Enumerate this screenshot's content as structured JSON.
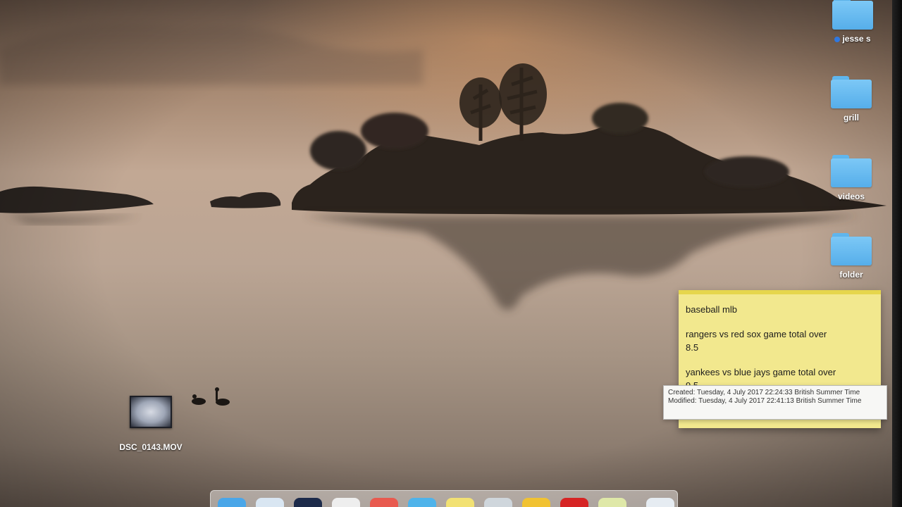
{
  "desktop": {
    "folders": [
      {
        "label": "jesse s",
        "tagged": true
      },
      {
        "label": "grill",
        "tagged": false
      },
      {
        "label": "videos",
        "tagged": false
      },
      {
        "label": "folder",
        "tagged": false
      }
    ],
    "file": {
      "label": "DSC_0143.MOV"
    }
  },
  "sticky_note": {
    "line1": "baseball mlb",
    "line2": "rangers vs red sox game total over",
    "line3": "8.5",
    "line4": "yankees vs blue jays game total over",
    "line5": "9.5"
  },
  "tooltip": {
    "created": "Created: Tuesday, 4 July 2017 22:24:33 British Summer Time",
    "modified": "Modified: Tuesday, 4 July 2017 22:41:13 British Summer Time"
  },
  "dock": {
    "items": [
      {
        "icon": "finder-icon",
        "color": "#4aa6e8"
      },
      {
        "icon": "safari-icon",
        "color": "#d9e6f2"
      },
      {
        "icon": "terminal-icon",
        "color": "#1c2a4a"
      },
      {
        "icon": "textedit-icon",
        "color": "#eeeeee"
      },
      {
        "icon": "calendar-icon",
        "color": "#e85a4f"
      },
      {
        "icon": "app-store-icon",
        "color": "#4fb3ea"
      },
      {
        "icon": "notes-icon",
        "color": "#f2e173"
      },
      {
        "icon": "preview-icon",
        "color": "#cfd6dc"
      },
      {
        "icon": "chrome-icon",
        "color": "#f1c232"
      },
      {
        "icon": "opera-icon",
        "color": "#d62424"
      },
      {
        "icon": "stickies-icon",
        "color": "#dfe8a8"
      },
      {
        "icon": "trash-icon",
        "color": "#e6ecf2"
      }
    ]
  },
  "colors": {
    "folder": "#5fb6ee",
    "sticky": "#f2e88e",
    "tag": "#2f78e0"
  }
}
